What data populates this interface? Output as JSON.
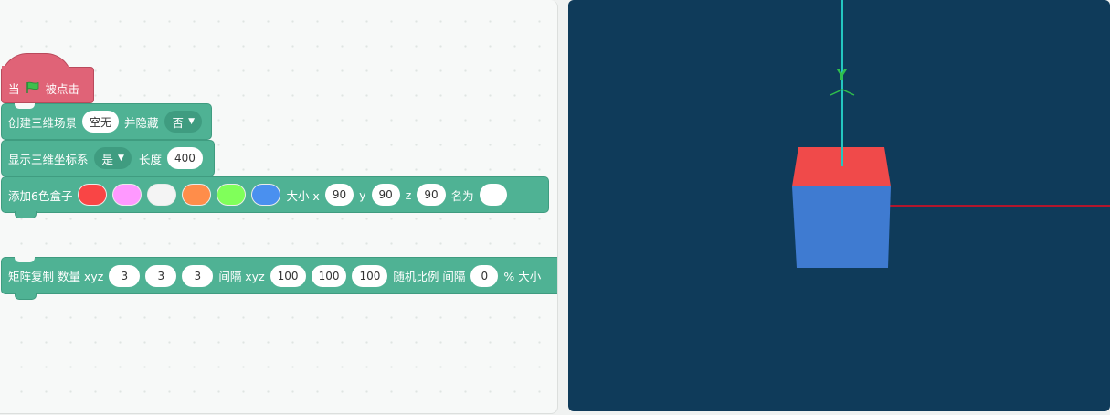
{
  "colors": {
    "event_block": "#e06377",
    "looks_block": "#4fb294",
    "viewport_bg": "#0f3b5a",
    "axis_y": "#24c7c1",
    "axis_x": "#b3162c",
    "cube_top": "#f04a4a",
    "cube_front": "#3f7bd1"
  },
  "blocks": {
    "hat": {
      "when": "当",
      "flag_icon": "green-flag-icon",
      "clicked": "被点击"
    },
    "create_scene": {
      "label": "创建三维场景",
      "scene_value": "空无",
      "hide_label": "并隐藏",
      "hide_value": "否"
    },
    "show_axes": {
      "label": "显示三维坐标系",
      "show_value": "是",
      "length_label": "长度",
      "length_value": "400"
    },
    "add_box": {
      "label": "添加6色盒子",
      "face_colors": [
        "#f94545",
        "#ff99ff",
        "#f4f4f4",
        "#ff8d4a",
        "#80ff5a",
        "#4a90ef"
      ],
      "size_label": "大小 x",
      "x_value": "90",
      "y_label": "y",
      "y_value": "90",
      "z_label": "z",
      "z_value": "90",
      "name_label": "名为",
      "name_value": ""
    },
    "matrix_copy": {
      "label": "矩阵复制 数量 xyz",
      "count_x": "3",
      "count_y": "3",
      "count_z": "3",
      "spacing_label": "间隔 xyz",
      "spacing_x": "100",
      "spacing_y": "100",
      "spacing_z": "100",
      "ratio_label": "随机比例 间隔",
      "ratio_value": "0",
      "tail_label": "% 大小"
    }
  },
  "viewport": {
    "y_axis_label": "Y"
  }
}
